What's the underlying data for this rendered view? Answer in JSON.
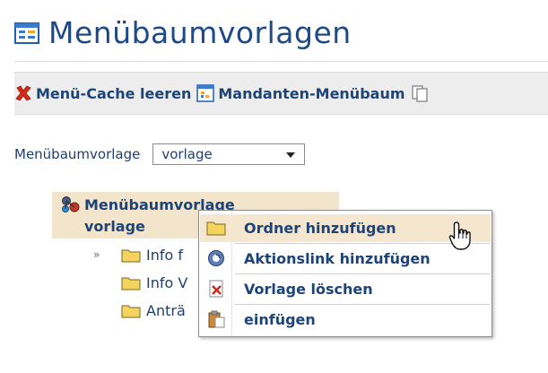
{
  "page": {
    "title": "Menübaumvorlagen",
    "title_icon": "template-grid-icon"
  },
  "toolbar": {
    "clear_cache_label": "Menü-Cache leeren",
    "clear_cache_icon": "red-x-icon",
    "tenant_menu_label": "Mandanten-Menübaum",
    "tenant_menu_icon": "tree-grid-icon",
    "copy_icon": "copy-icon"
  },
  "selector": {
    "label": "Menübaumvorlage",
    "value": "vorlage"
  },
  "tree": {
    "root_label_line1": "Menübaumvorlage",
    "root_label_line2": "vorlage",
    "expander": "»",
    "children": [
      {
        "label": "Info f"
      },
      {
        "label": "Info V"
      },
      {
        "label": "Anträ"
      }
    ]
  },
  "context_menu": {
    "items": [
      {
        "label": "Ordner hinzufügen",
        "icon": "folder-icon"
      },
      {
        "label": "Aktionslink hinzufügen",
        "icon": "action-link-icon"
      },
      {
        "label": "Vorlage löschen",
        "icon": "delete-document-icon"
      },
      {
        "label": "einfügen",
        "icon": "paste-icon"
      }
    ]
  },
  "colors": {
    "accent_text": "#1d4478",
    "highlight": "#f4e6cf",
    "toolbar_bg": "#ededed",
    "delete_red": "#d42a1a",
    "folder_yellow": "#f4d35e"
  }
}
